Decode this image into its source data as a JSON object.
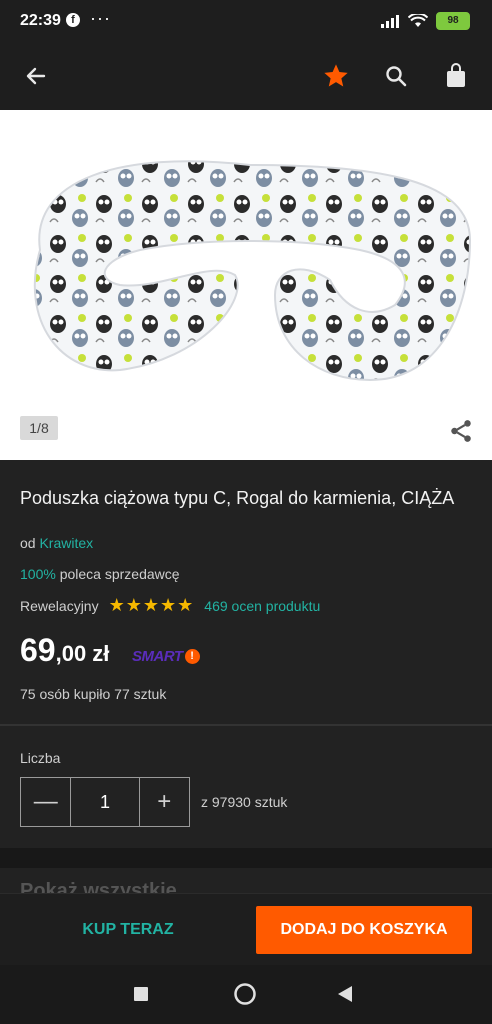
{
  "status": {
    "time": "22:39",
    "fb": "f",
    "dots": "···",
    "battery": "98"
  },
  "appbar": {
    "back_icon": "arrow-left-icon",
    "favorite_icon": "star-icon",
    "search_icon": "search-icon",
    "cart_icon": "shopping-bag-icon",
    "accent": "#ff5a00"
  },
  "gallery": {
    "counter": "1/8",
    "share_icon": "share-icon"
  },
  "product": {
    "title": "Poduszka ciążowa typu C, Rogal do karmienia, CIĄŻA",
    "seller_prefix": "od",
    "seller_name": "Krawitex",
    "recommend_pct": "100%",
    "recommend_text": "poleca sprzedawcę",
    "rating_label": "Rewelacyjny",
    "stars": "★★★★★",
    "reviews": "469 ocen produktu",
    "price_main": "69",
    "price_rest": ",00 zł",
    "smart_label": "SMART",
    "smart_badge": "!",
    "bought": "75 osób kupiło 77 sztuk"
  },
  "quantity": {
    "label": "Liczba",
    "minus": "—",
    "value": "1",
    "plus": "+",
    "stock": "z 97930 sztuk"
  },
  "section_peek": "Pokaż wszystkie",
  "actions": {
    "buy_now": "KUP TERAZ",
    "add_to_cart": "DODAJ DO KOSZYKA"
  },
  "navbar": {
    "recent_icon": "square-icon",
    "home_icon": "circle-icon",
    "back_icon": "triangle-back-icon"
  }
}
